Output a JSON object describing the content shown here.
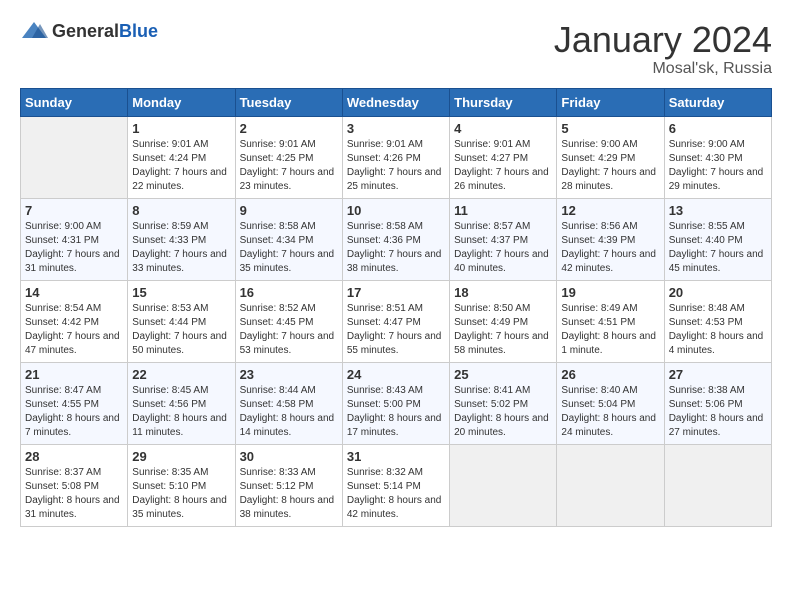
{
  "header": {
    "logo_general": "General",
    "logo_blue": "Blue",
    "month_title": "January 2024",
    "location": "Mosal'sk, Russia"
  },
  "days_of_week": [
    "Sunday",
    "Monday",
    "Tuesday",
    "Wednesday",
    "Thursday",
    "Friday",
    "Saturday"
  ],
  "weeks": [
    [
      {
        "day": "",
        "sunrise": "",
        "sunset": "",
        "daylight": ""
      },
      {
        "day": "1",
        "sunrise": "Sunrise: 9:01 AM",
        "sunset": "Sunset: 4:24 PM",
        "daylight": "Daylight: 7 hours and 22 minutes."
      },
      {
        "day": "2",
        "sunrise": "Sunrise: 9:01 AM",
        "sunset": "Sunset: 4:25 PM",
        "daylight": "Daylight: 7 hours and 23 minutes."
      },
      {
        "day": "3",
        "sunrise": "Sunrise: 9:01 AM",
        "sunset": "Sunset: 4:26 PM",
        "daylight": "Daylight: 7 hours and 25 minutes."
      },
      {
        "day": "4",
        "sunrise": "Sunrise: 9:01 AM",
        "sunset": "Sunset: 4:27 PM",
        "daylight": "Daylight: 7 hours and 26 minutes."
      },
      {
        "day": "5",
        "sunrise": "Sunrise: 9:00 AM",
        "sunset": "Sunset: 4:29 PM",
        "daylight": "Daylight: 7 hours and 28 minutes."
      },
      {
        "day": "6",
        "sunrise": "Sunrise: 9:00 AM",
        "sunset": "Sunset: 4:30 PM",
        "daylight": "Daylight: 7 hours and 29 minutes."
      }
    ],
    [
      {
        "day": "7",
        "sunrise": "Sunrise: 9:00 AM",
        "sunset": "Sunset: 4:31 PM",
        "daylight": "Daylight: 7 hours and 31 minutes."
      },
      {
        "day": "8",
        "sunrise": "Sunrise: 8:59 AM",
        "sunset": "Sunset: 4:33 PM",
        "daylight": "Daylight: 7 hours and 33 minutes."
      },
      {
        "day": "9",
        "sunrise": "Sunrise: 8:58 AM",
        "sunset": "Sunset: 4:34 PM",
        "daylight": "Daylight: 7 hours and 35 minutes."
      },
      {
        "day": "10",
        "sunrise": "Sunrise: 8:58 AM",
        "sunset": "Sunset: 4:36 PM",
        "daylight": "Daylight: 7 hours and 38 minutes."
      },
      {
        "day": "11",
        "sunrise": "Sunrise: 8:57 AM",
        "sunset": "Sunset: 4:37 PM",
        "daylight": "Daylight: 7 hours and 40 minutes."
      },
      {
        "day": "12",
        "sunrise": "Sunrise: 8:56 AM",
        "sunset": "Sunset: 4:39 PM",
        "daylight": "Daylight: 7 hours and 42 minutes."
      },
      {
        "day": "13",
        "sunrise": "Sunrise: 8:55 AM",
        "sunset": "Sunset: 4:40 PM",
        "daylight": "Daylight: 7 hours and 45 minutes."
      }
    ],
    [
      {
        "day": "14",
        "sunrise": "Sunrise: 8:54 AM",
        "sunset": "Sunset: 4:42 PM",
        "daylight": "Daylight: 7 hours and 47 minutes."
      },
      {
        "day": "15",
        "sunrise": "Sunrise: 8:53 AM",
        "sunset": "Sunset: 4:44 PM",
        "daylight": "Daylight: 7 hours and 50 minutes."
      },
      {
        "day": "16",
        "sunrise": "Sunrise: 8:52 AM",
        "sunset": "Sunset: 4:45 PM",
        "daylight": "Daylight: 7 hours and 53 minutes."
      },
      {
        "day": "17",
        "sunrise": "Sunrise: 8:51 AM",
        "sunset": "Sunset: 4:47 PM",
        "daylight": "Daylight: 7 hours and 55 minutes."
      },
      {
        "day": "18",
        "sunrise": "Sunrise: 8:50 AM",
        "sunset": "Sunset: 4:49 PM",
        "daylight": "Daylight: 7 hours and 58 minutes."
      },
      {
        "day": "19",
        "sunrise": "Sunrise: 8:49 AM",
        "sunset": "Sunset: 4:51 PM",
        "daylight": "Daylight: 8 hours and 1 minute."
      },
      {
        "day": "20",
        "sunrise": "Sunrise: 8:48 AM",
        "sunset": "Sunset: 4:53 PM",
        "daylight": "Daylight: 8 hours and 4 minutes."
      }
    ],
    [
      {
        "day": "21",
        "sunrise": "Sunrise: 8:47 AM",
        "sunset": "Sunset: 4:55 PM",
        "daylight": "Daylight: 8 hours and 7 minutes."
      },
      {
        "day": "22",
        "sunrise": "Sunrise: 8:45 AM",
        "sunset": "Sunset: 4:56 PM",
        "daylight": "Daylight: 8 hours and 11 minutes."
      },
      {
        "day": "23",
        "sunrise": "Sunrise: 8:44 AM",
        "sunset": "Sunset: 4:58 PM",
        "daylight": "Daylight: 8 hours and 14 minutes."
      },
      {
        "day": "24",
        "sunrise": "Sunrise: 8:43 AM",
        "sunset": "Sunset: 5:00 PM",
        "daylight": "Daylight: 8 hours and 17 minutes."
      },
      {
        "day": "25",
        "sunrise": "Sunrise: 8:41 AM",
        "sunset": "Sunset: 5:02 PM",
        "daylight": "Daylight: 8 hours and 20 minutes."
      },
      {
        "day": "26",
        "sunrise": "Sunrise: 8:40 AM",
        "sunset": "Sunset: 5:04 PM",
        "daylight": "Daylight: 8 hours and 24 minutes."
      },
      {
        "day": "27",
        "sunrise": "Sunrise: 8:38 AM",
        "sunset": "Sunset: 5:06 PM",
        "daylight": "Daylight: 8 hours and 27 minutes."
      }
    ],
    [
      {
        "day": "28",
        "sunrise": "Sunrise: 8:37 AM",
        "sunset": "Sunset: 5:08 PM",
        "daylight": "Daylight: 8 hours and 31 minutes."
      },
      {
        "day": "29",
        "sunrise": "Sunrise: 8:35 AM",
        "sunset": "Sunset: 5:10 PM",
        "daylight": "Daylight: 8 hours and 35 minutes."
      },
      {
        "day": "30",
        "sunrise": "Sunrise: 8:33 AM",
        "sunset": "Sunset: 5:12 PM",
        "daylight": "Daylight: 8 hours and 38 minutes."
      },
      {
        "day": "31",
        "sunrise": "Sunrise: 8:32 AM",
        "sunset": "Sunset: 5:14 PM",
        "daylight": "Daylight: 8 hours and 42 minutes."
      },
      {
        "day": "",
        "sunrise": "",
        "sunset": "",
        "daylight": ""
      },
      {
        "day": "",
        "sunrise": "",
        "sunset": "",
        "daylight": ""
      },
      {
        "day": "",
        "sunrise": "",
        "sunset": "",
        "daylight": ""
      }
    ]
  ]
}
